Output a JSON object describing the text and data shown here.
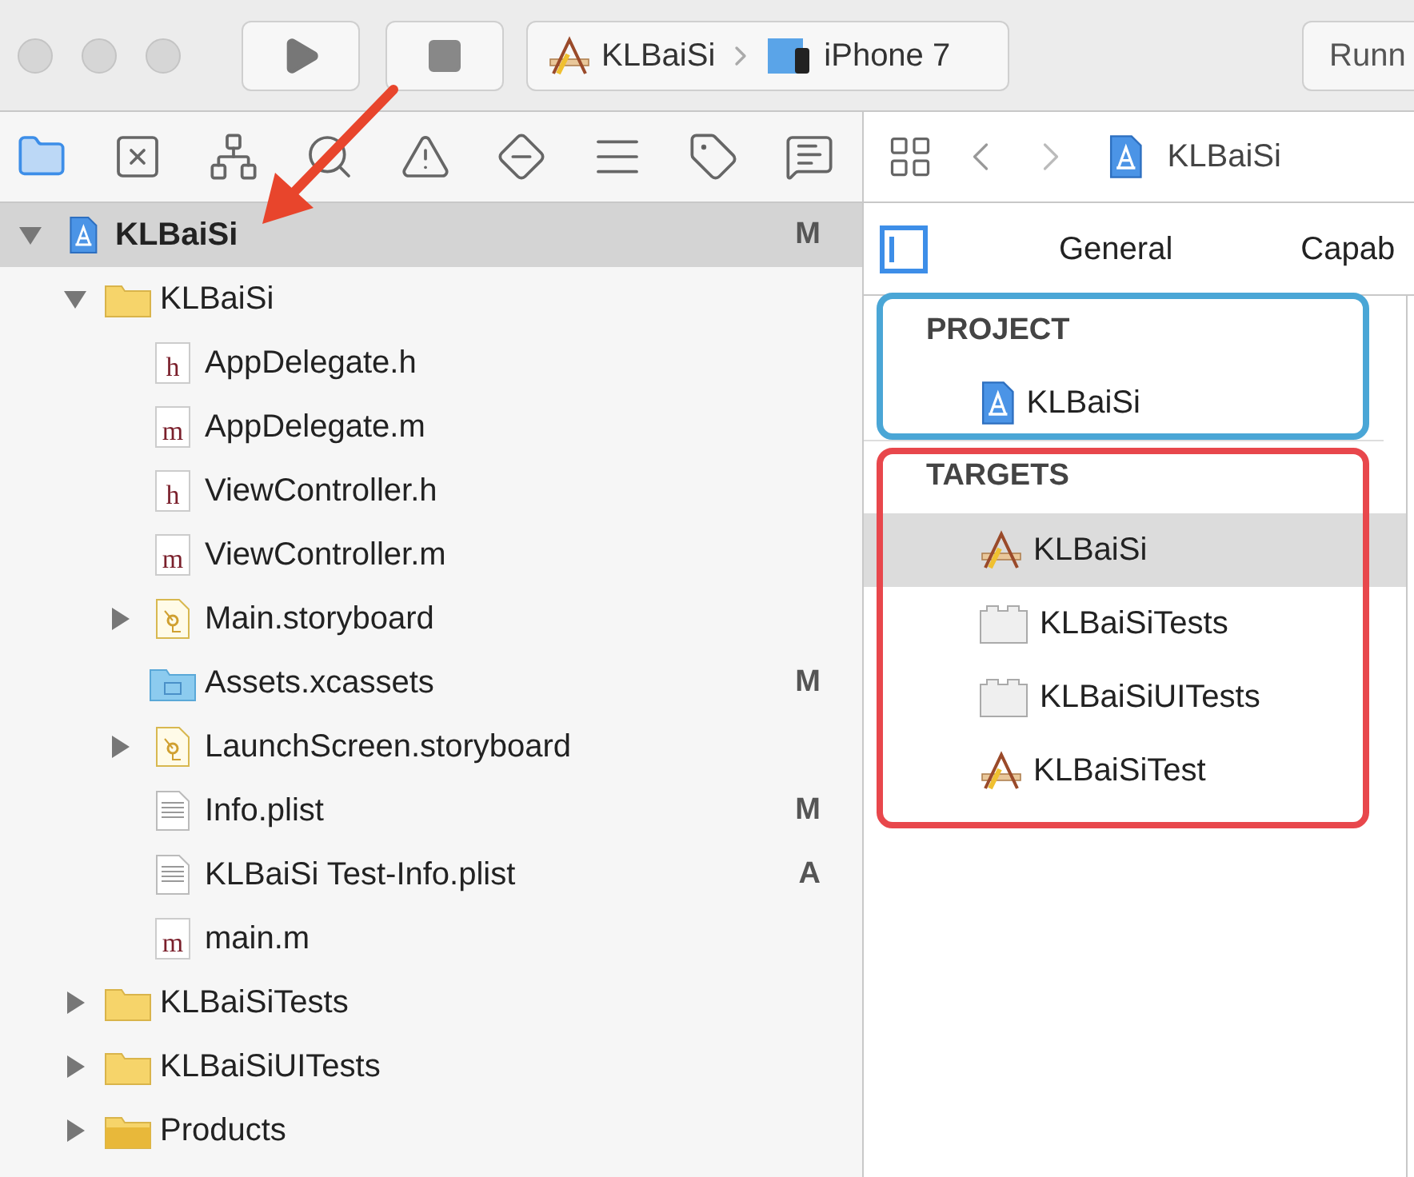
{
  "toolbar": {
    "window_buttons": [
      {
        "active": false
      },
      {
        "active": false
      },
      {
        "active": false
      }
    ],
    "scheme": {
      "target": "KLBaiSi",
      "device": "iPhone 7"
    },
    "status": "Runn"
  },
  "navigator_tabs": [
    {
      "kind": "folder",
      "selected": true
    },
    {
      "kind": "symbol",
      "selected": false
    },
    {
      "kind": "hierarchy",
      "selected": false
    },
    {
      "kind": "search",
      "selected": false
    },
    {
      "kind": "warning",
      "selected": false
    },
    {
      "kind": "test",
      "selected": false
    },
    {
      "kind": "list",
      "selected": false
    },
    {
      "kind": "tag",
      "selected": false
    },
    {
      "kind": "message",
      "selected": false
    }
  ],
  "tree": [
    {
      "label": "KLBaiSi",
      "kind": "project",
      "status": "M",
      "selected": true,
      "expanded": true,
      "children": [
        {
          "label": "KLBaiSi",
          "kind": "folder",
          "selected": false,
          "expanded": true,
          "children": [
            {
              "label": "AppDelegate.h",
              "kind": "source",
              "icon_text": "h",
              "selected": false
            },
            {
              "label": "AppDelegate.m",
              "kind": "source",
              "icon_text": "m",
              "selected": false
            },
            {
              "label": "ViewController.h",
              "kind": "source",
              "icon_text": "h",
              "selected": false
            },
            {
              "label": "ViewController.m",
              "kind": "source",
              "icon_text": "m",
              "selected": false
            },
            {
              "label": "Main.storyboard",
              "kind": "storyboard",
              "selected": false,
              "expanded": false
            },
            {
              "label": "Assets.xcassets",
              "kind": "assets",
              "status": "M",
              "selected": false
            },
            {
              "label": "LaunchScreen.storyboard",
              "kind": "storyboard",
              "selected": false,
              "expanded": false
            },
            {
              "label": "Info.plist",
              "kind": "plist",
              "status": "M",
              "selected": false
            },
            {
              "label": "KLBaiSi Test-Info.plist",
              "kind": "plist",
              "status": "A",
              "selected": false
            },
            {
              "label": "main.m",
              "kind": "source",
              "icon_text": "m",
              "selected": false
            }
          ]
        },
        {
          "label": "KLBaiSiTests",
          "kind": "folder",
          "selected": false,
          "expanded": false
        },
        {
          "label": "KLBaiSiUITests",
          "kind": "folder",
          "selected": false,
          "expanded": false
        },
        {
          "label": "Products",
          "kind": "products",
          "selected": false,
          "expanded": false
        }
      ]
    }
  ],
  "editor": {
    "breadcrumb": "KLBaiSi",
    "tabs": [
      {
        "label": "General",
        "selected": false
      },
      {
        "label": "Capab",
        "selected": false
      }
    ],
    "sections": [
      {
        "title": "PROJECT",
        "items": [
          {
            "label": "KLBaiSi",
            "kind": "project",
            "selected": false
          }
        ]
      },
      {
        "title": "TARGETS",
        "items": [
          {
            "label": "KLBaiSi",
            "kind": "app",
            "selected": true
          },
          {
            "label": "KLBaiSiTests",
            "kind": "bundle",
            "selected": false
          },
          {
            "label": "KLBaiSiUITests",
            "kind": "bundle",
            "selected": false
          },
          {
            "label": "KLBaiSiTest",
            "kind": "app",
            "selected": false
          }
        ]
      }
    ]
  },
  "annotations": [
    {
      "kind": "arrow",
      "color": "#e8452c"
    },
    {
      "kind": "frame",
      "color": "#4aa6d6"
    },
    {
      "kind": "frame",
      "color": "#e8474c"
    }
  ]
}
